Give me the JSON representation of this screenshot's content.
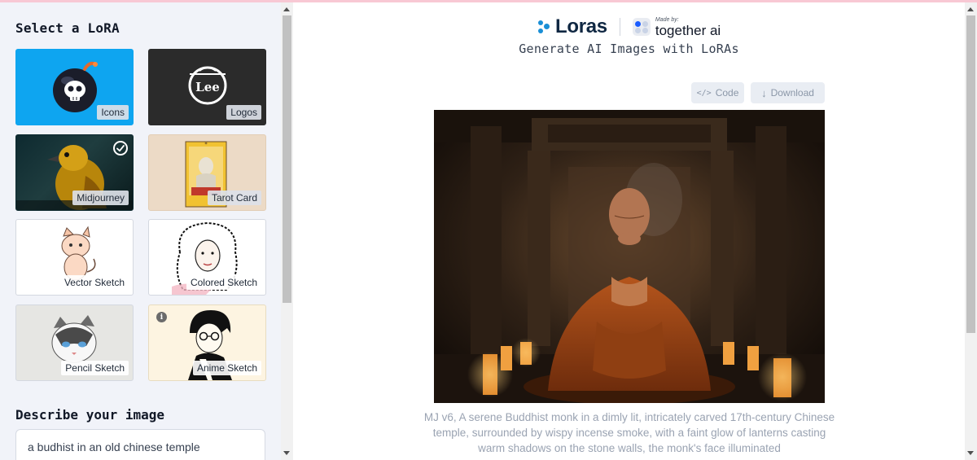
{
  "sidebar": {
    "title": "Select a LoRA",
    "cards": [
      {
        "label": "Icons"
      },
      {
        "label": "Logos"
      },
      {
        "label": "Midjourney",
        "selected": true
      },
      {
        "label": "Tarot Card"
      },
      {
        "label": "Vector Sketch"
      },
      {
        "label": "Colored Sketch"
      },
      {
        "label": "Pencil Sketch"
      },
      {
        "label": "Anime Sketch"
      }
    ],
    "logo_card_text": "Lee",
    "describe_label": "Describe your image",
    "prompt_value": "a budhist in an old chinese temple"
  },
  "header": {
    "brand": "Loras",
    "made_by": "Made by:",
    "partner": "together ai",
    "subtitle": "Generate AI Images with LoRAs"
  },
  "toolbar": {
    "code_label": "Code",
    "download_label": "Download",
    "code_glyph": "</>",
    "download_glyph": "↓"
  },
  "result": {
    "caption": "MJ v6, A serene Buddhist monk in a dimly lit, intricately carved 17th-century Chinese temple, surrounded by wispy incense smoke, with a faint glow of lanterns casting warm shadows on the stone walls, the monk's face illuminated"
  },
  "colors": {
    "brand_blue": "#1a8fd6",
    "icons_card": "#0ea5f0",
    "selected_check": "#ffffff"
  }
}
